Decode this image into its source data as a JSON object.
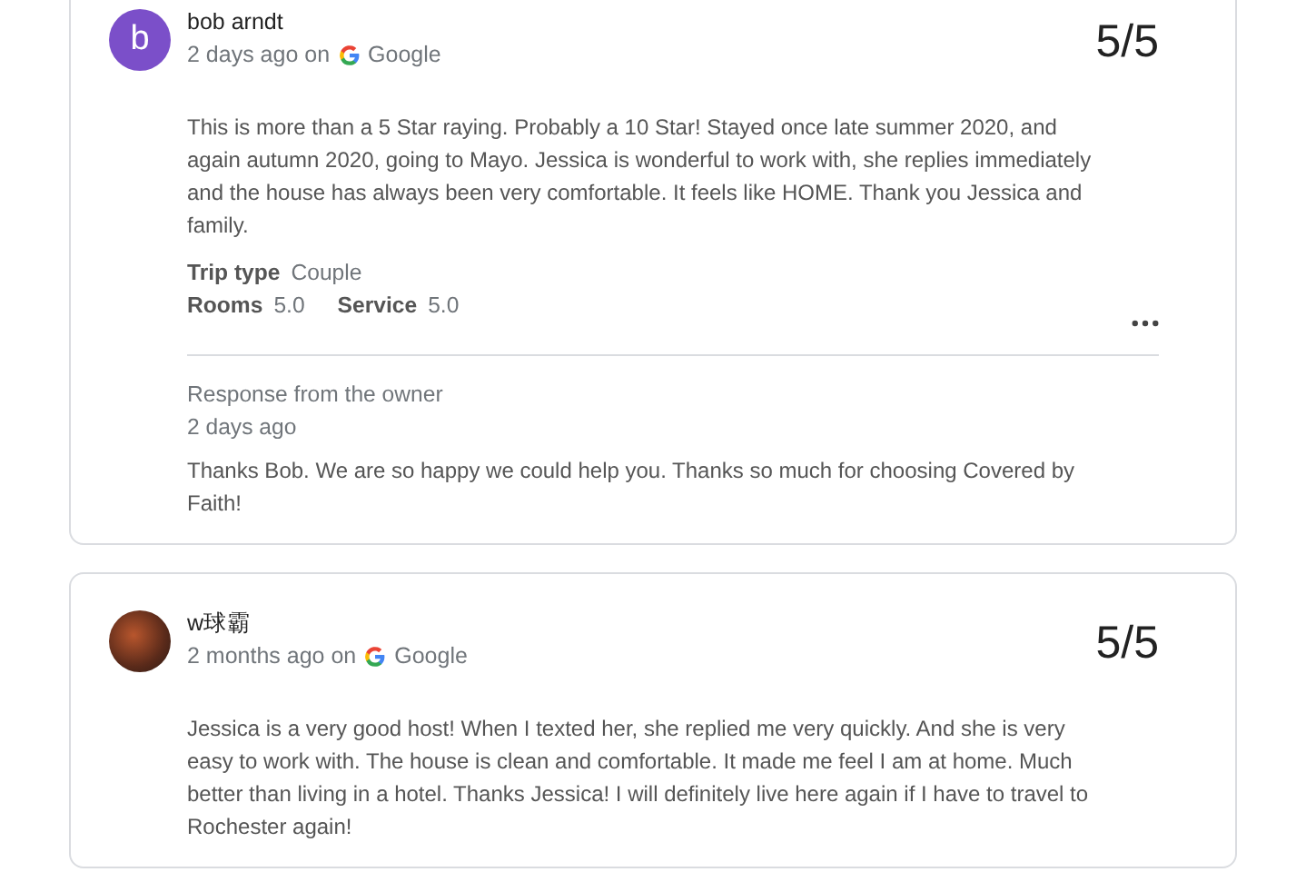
{
  "reviews": [
    {
      "avatar": {
        "kind": "letter",
        "letter": "b"
      },
      "reviewer": "bob arndt",
      "time": "2 days ago on",
      "source": "Google",
      "score": "5/5",
      "text": "This is more than a 5 Star raying. Probably a 10 Star! Stayed once late summer 2020, and again autumn 2020, going to Mayo. Jessica is wonderful to work with, she replies immediately and the house has always been very comfortable. It feels like HOME. Thank you Jessica and family.",
      "details": [
        {
          "label": "Trip type",
          "value": "Couple"
        }
      ],
      "ratings": [
        {
          "label": "Rooms",
          "value": "5.0"
        },
        {
          "label": "Service",
          "value": "5.0"
        }
      ],
      "more_menu": true,
      "owner_response": {
        "heading": "Response from the owner",
        "time": "2 days ago",
        "text": "Thanks Bob. We are so happy we could help you. Thanks so much for choosing Covered by Faith!"
      }
    },
    {
      "avatar": {
        "kind": "photo"
      },
      "reviewer": "w球霸",
      "time": "2 months ago on",
      "source": "Google",
      "score": "5/5",
      "text": "Jessica is a very good host! When I texted her, she replied me very quickly. And she is very easy to work with. The house is clean and comfortable. It made me feel I am at home. Much better than living in a hotel. Thanks Jessica! I will definitely live here again if I have to travel to Rochester again!"
    }
  ]
}
